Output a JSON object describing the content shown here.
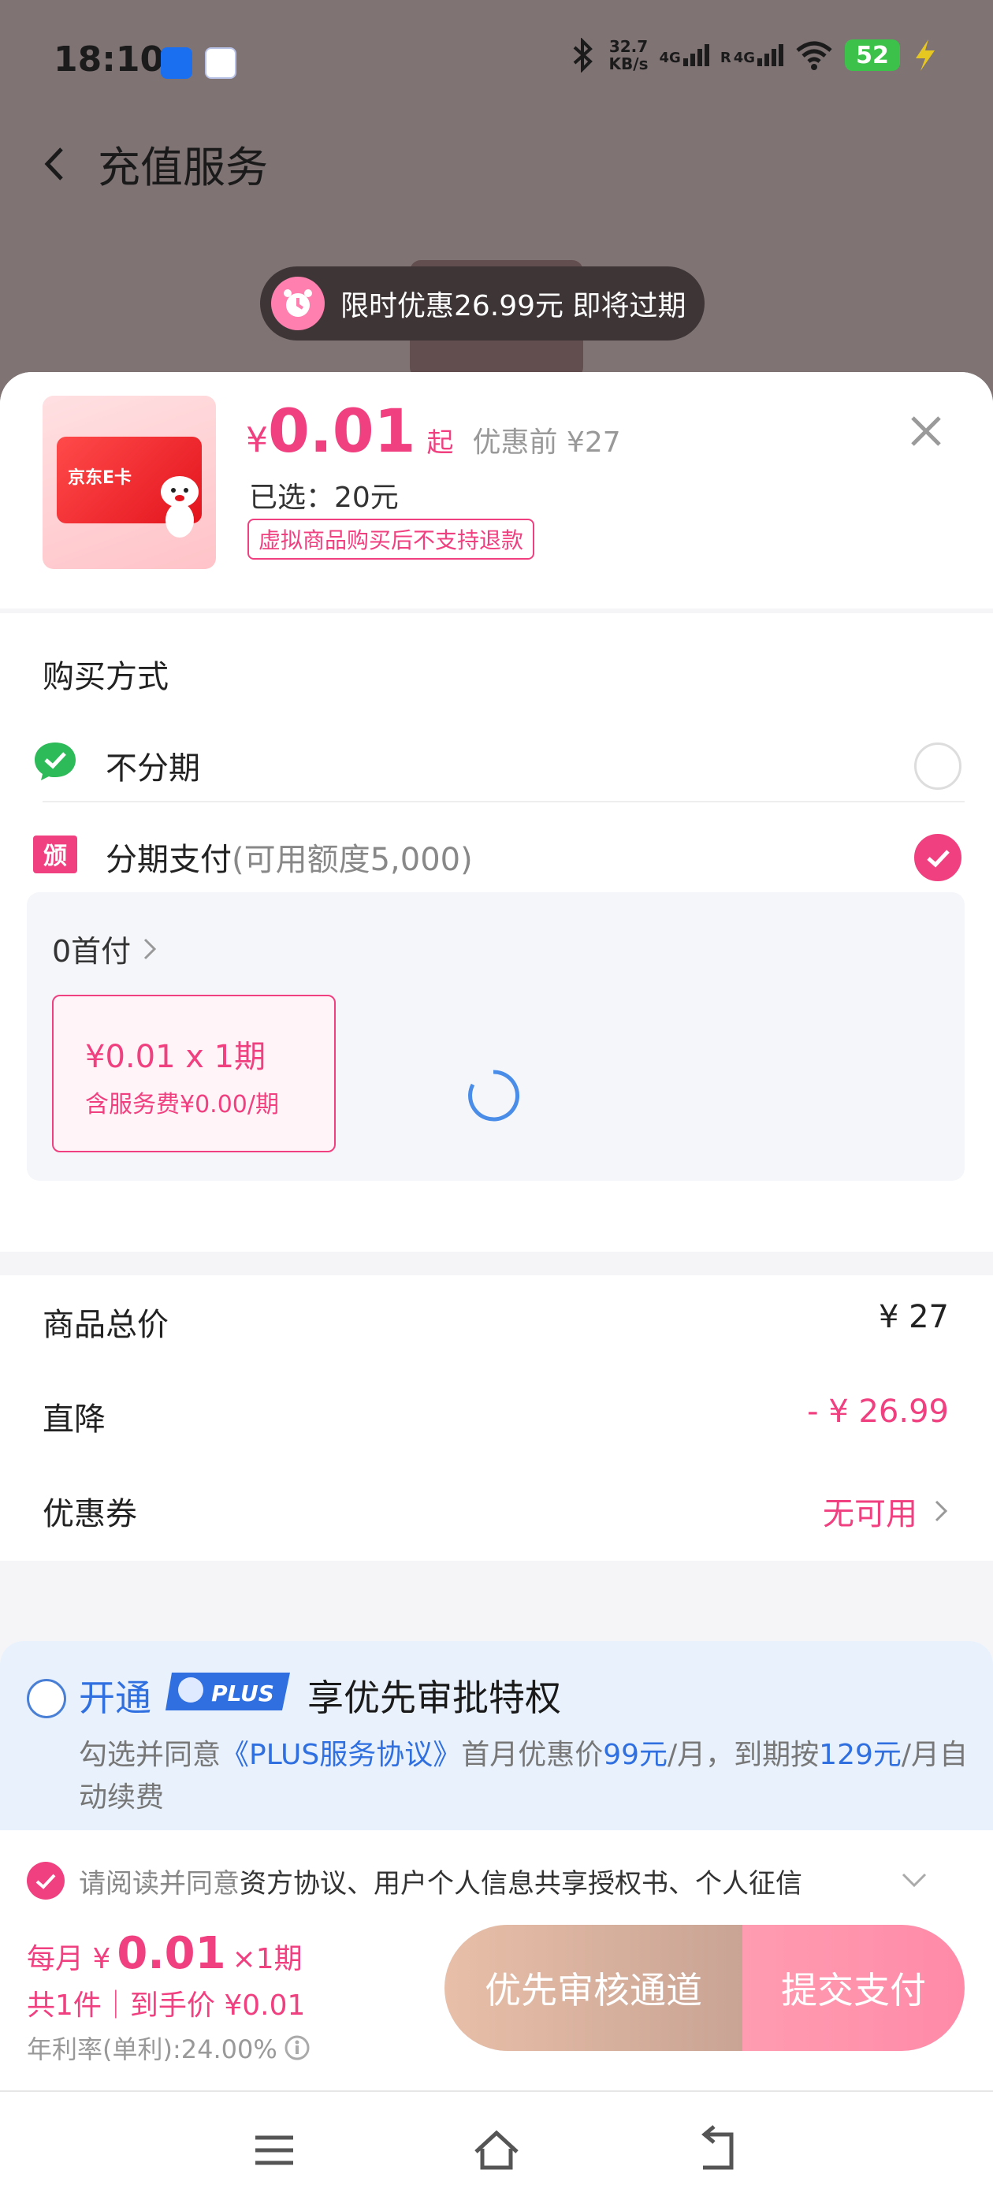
{
  "status_bar": {
    "time": "18:10",
    "net_speed_value": "32.7",
    "net_speed_unit": "KB/s",
    "sim1": "4G",
    "sim2": "4G",
    "sim2_roaming": "R",
    "battery": "52"
  },
  "header": {
    "title": "充值服务"
  },
  "promo": {
    "text": "限时优惠26.99元 即将过期"
  },
  "product": {
    "card_text": "京东E卡",
    "currency": "¥",
    "price": "0.01",
    "from": "起",
    "original_price": "优惠前 ¥27",
    "selected": "已选：20元",
    "refund_notice": "虚拟商品购买后不支持退款"
  },
  "purchase": {
    "title": "购买方式",
    "options": [
      {
        "label": "不分期",
        "sub": "",
        "selected": false
      },
      {
        "label": "分期支付",
        "sub": "(可用额度5,000)",
        "selected": true
      }
    ],
    "down_payment": "0首付",
    "plan": {
      "main": "¥0.01 x 1期",
      "fee": "含服务费¥0.00/期"
    }
  },
  "pricing": {
    "total_label": "商品总价",
    "total_value": "¥ 27",
    "discount_label": "直降",
    "discount_value": "- ¥ 26.99",
    "coupon_label": "优惠券",
    "coupon_value": "无可用"
  },
  "plus": {
    "open": "开通",
    "badge": "PLUS",
    "privilege": "享优先审批特权",
    "desc_1": "勾选并同意",
    "desc_link": "《PLUS服务协议》",
    "desc_2": "首月优惠价",
    "desc_price1": "99元",
    "desc_3": "/月，到期按",
    "desc_price2": "129元",
    "desc_4": "/月自动续费"
  },
  "agreement": {
    "prefix": "请阅读并同意",
    "docs": "资方协议、用户个人信息共享授权书、个人征信"
  },
  "footer": {
    "monthly_prefix": "每月 ¥",
    "monthly_amount": "0.01",
    "monthly_suffix": "×1期",
    "summary": "共1件｜到手价 ¥0.01",
    "apr": "年利率(单利):24.00%",
    "priority_button": "优先审核通道",
    "submit_button": "提交支付"
  },
  "colors": {
    "accent": "#f0407f",
    "blue": "#2f6fe0",
    "overlay": "#7f7374"
  }
}
